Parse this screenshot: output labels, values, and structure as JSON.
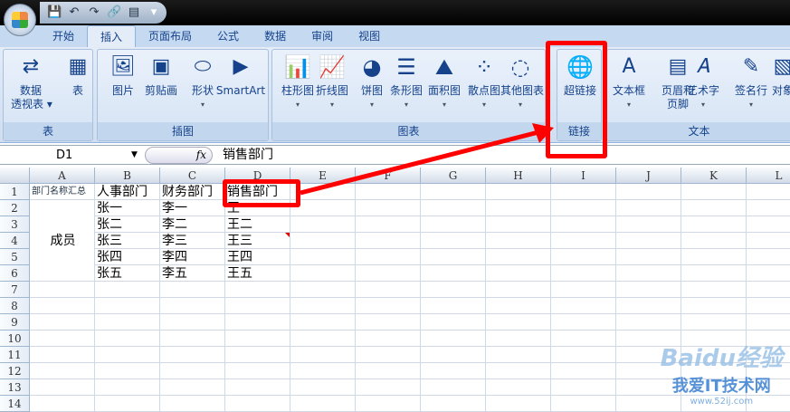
{
  "quick_access": {
    "save": "💾",
    "undo": "↶",
    "redo": "↷",
    "hyperlink": "🔗",
    "form": "▤",
    "customize": "▾"
  },
  "tabs": [
    "开始",
    "插入",
    "页面布局",
    "公式",
    "数据",
    "审阅",
    "视图"
  ],
  "active_tab": "插入",
  "ribbon": {
    "groups": [
      {
        "label": "表",
        "buttons": [
          {
            "label": "数据\n透视表 ▾",
            "icon": "pivot-table"
          },
          {
            "label": "表",
            "icon": "table"
          }
        ]
      },
      {
        "label": "插图",
        "buttons": [
          {
            "label": "图片",
            "icon": "picture"
          },
          {
            "label": "剪贴画",
            "icon": "clip-art"
          },
          {
            "label": "形状",
            "icon": "shapes"
          },
          {
            "label": "SmartArt",
            "icon": "smartart"
          }
        ]
      },
      {
        "label": "图表",
        "buttons": [
          {
            "label": "柱形图",
            "icon": "column-chart"
          },
          {
            "label": "折线图",
            "icon": "line-chart"
          },
          {
            "label": "饼图",
            "icon": "pie-chart"
          },
          {
            "label": "条形图",
            "icon": "bar-chart"
          },
          {
            "label": "面积图",
            "icon": "area-chart"
          },
          {
            "label": "散点图",
            "icon": "scatter-chart"
          },
          {
            "label": "其他图表",
            "icon": "other-charts"
          }
        ]
      },
      {
        "label": "链接",
        "buttons": [
          {
            "label": "超链接",
            "icon": "hyperlink-globe"
          }
        ]
      },
      {
        "label": "文本",
        "buttons": [
          {
            "label": "文本框",
            "icon": "text-box"
          },
          {
            "label": "页眉和\n页脚",
            "icon": "header-footer"
          },
          {
            "label": "艺术字",
            "icon": "wordart"
          },
          {
            "label": "签名行",
            "icon": "signature-line"
          },
          {
            "label": "对象",
            "icon": "object"
          }
        ]
      }
    ]
  },
  "formula_bar": {
    "name_box": "D1",
    "fx": "fx",
    "value": "销售部门"
  },
  "columns": [
    "A",
    "B",
    "C",
    "D",
    "E",
    "F",
    "G",
    "H",
    "I",
    "J",
    "K",
    "L"
  ],
  "rows": [
    "1",
    "2",
    "3",
    "4",
    "5",
    "6",
    "7",
    "8",
    "9",
    "10",
    "11",
    "12",
    "13",
    "14"
  ],
  "cells": {
    "A1": "部门名称汇总",
    "B1": "人事部门",
    "C1": "财务部门",
    "D1": "销售部门",
    "A_merged": "成员",
    "B": [
      "张一",
      "张二",
      "张三",
      "张四",
      "张五"
    ],
    "C": [
      "李一",
      "李二",
      "李三",
      "李四",
      "李五"
    ],
    "D": [
      "王一",
      "王二",
      "王三",
      "王四",
      "王五"
    ]
  },
  "watermark": {
    "brand": "Baidu经验",
    "site": "我爱IT技术网",
    "url": "www.52ij.com"
  },
  "colors": {
    "highlight": "#ff0000",
    "ribbon": "#d0def0"
  }
}
